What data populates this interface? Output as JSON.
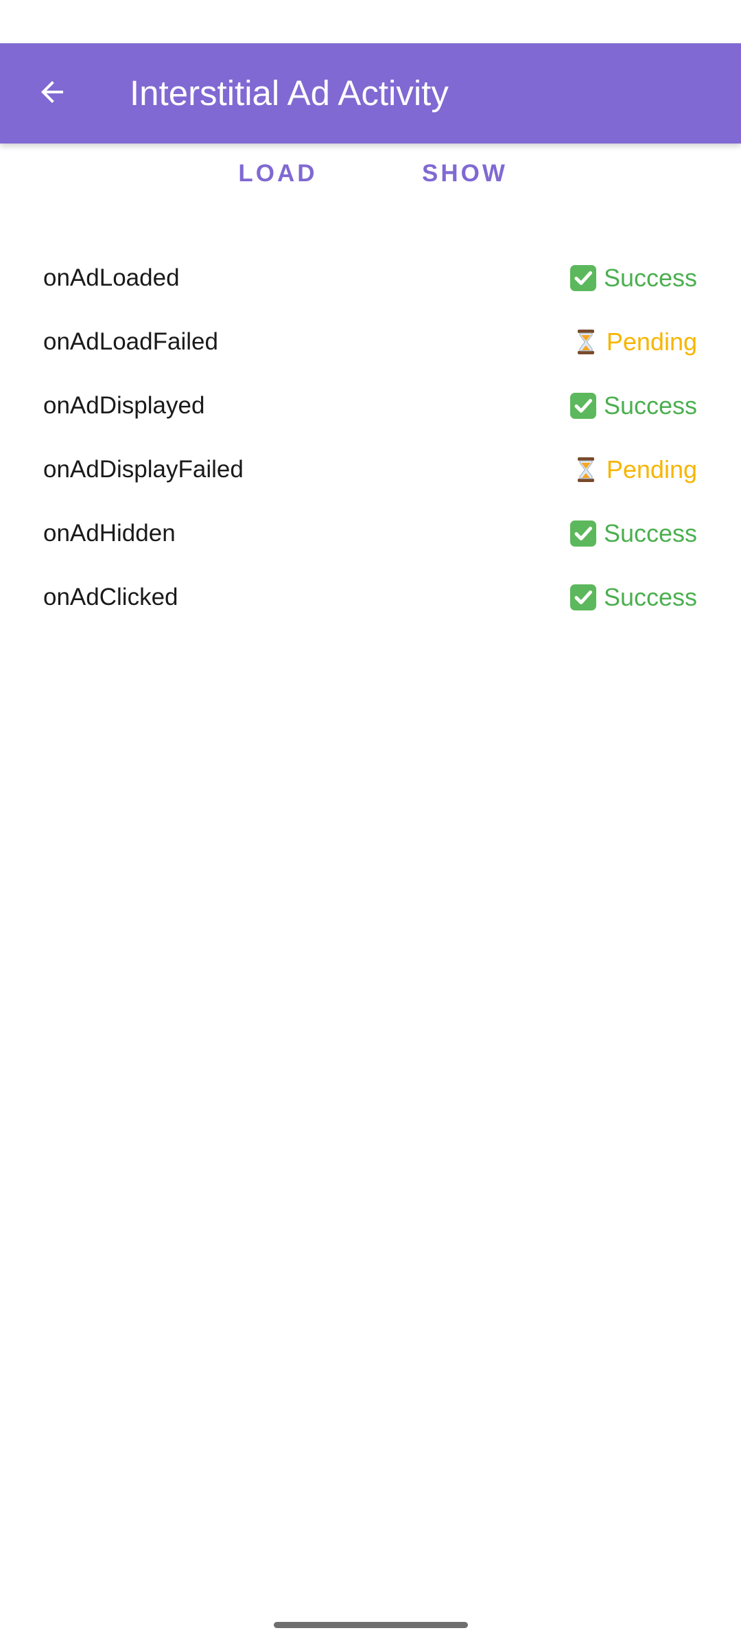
{
  "app_bar": {
    "title": "Interstitial Ad Activity",
    "background": "#8069d2",
    "back_icon": "arrow-back-icon"
  },
  "actions": {
    "load_label": "LOAD",
    "show_label": "SHOW"
  },
  "colors": {
    "accent": "#8069d2",
    "success": "#4caf50",
    "pending": "#f7b500"
  },
  "events": [
    {
      "name": "onAdLoaded",
      "status": "Success",
      "icon": "check-icon"
    },
    {
      "name": "onAdLoadFailed",
      "status": "Pending",
      "icon": "hourglass-icon"
    },
    {
      "name": "onAdDisplayed",
      "status": "Success",
      "icon": "check-icon"
    },
    {
      "name": "onAdDisplayFailed",
      "status": "Pending",
      "icon": "hourglass-icon"
    },
    {
      "name": "onAdHidden",
      "status": "Success",
      "icon": "check-icon"
    },
    {
      "name": "onAdClicked",
      "status": "Success",
      "icon": "check-icon"
    }
  ]
}
